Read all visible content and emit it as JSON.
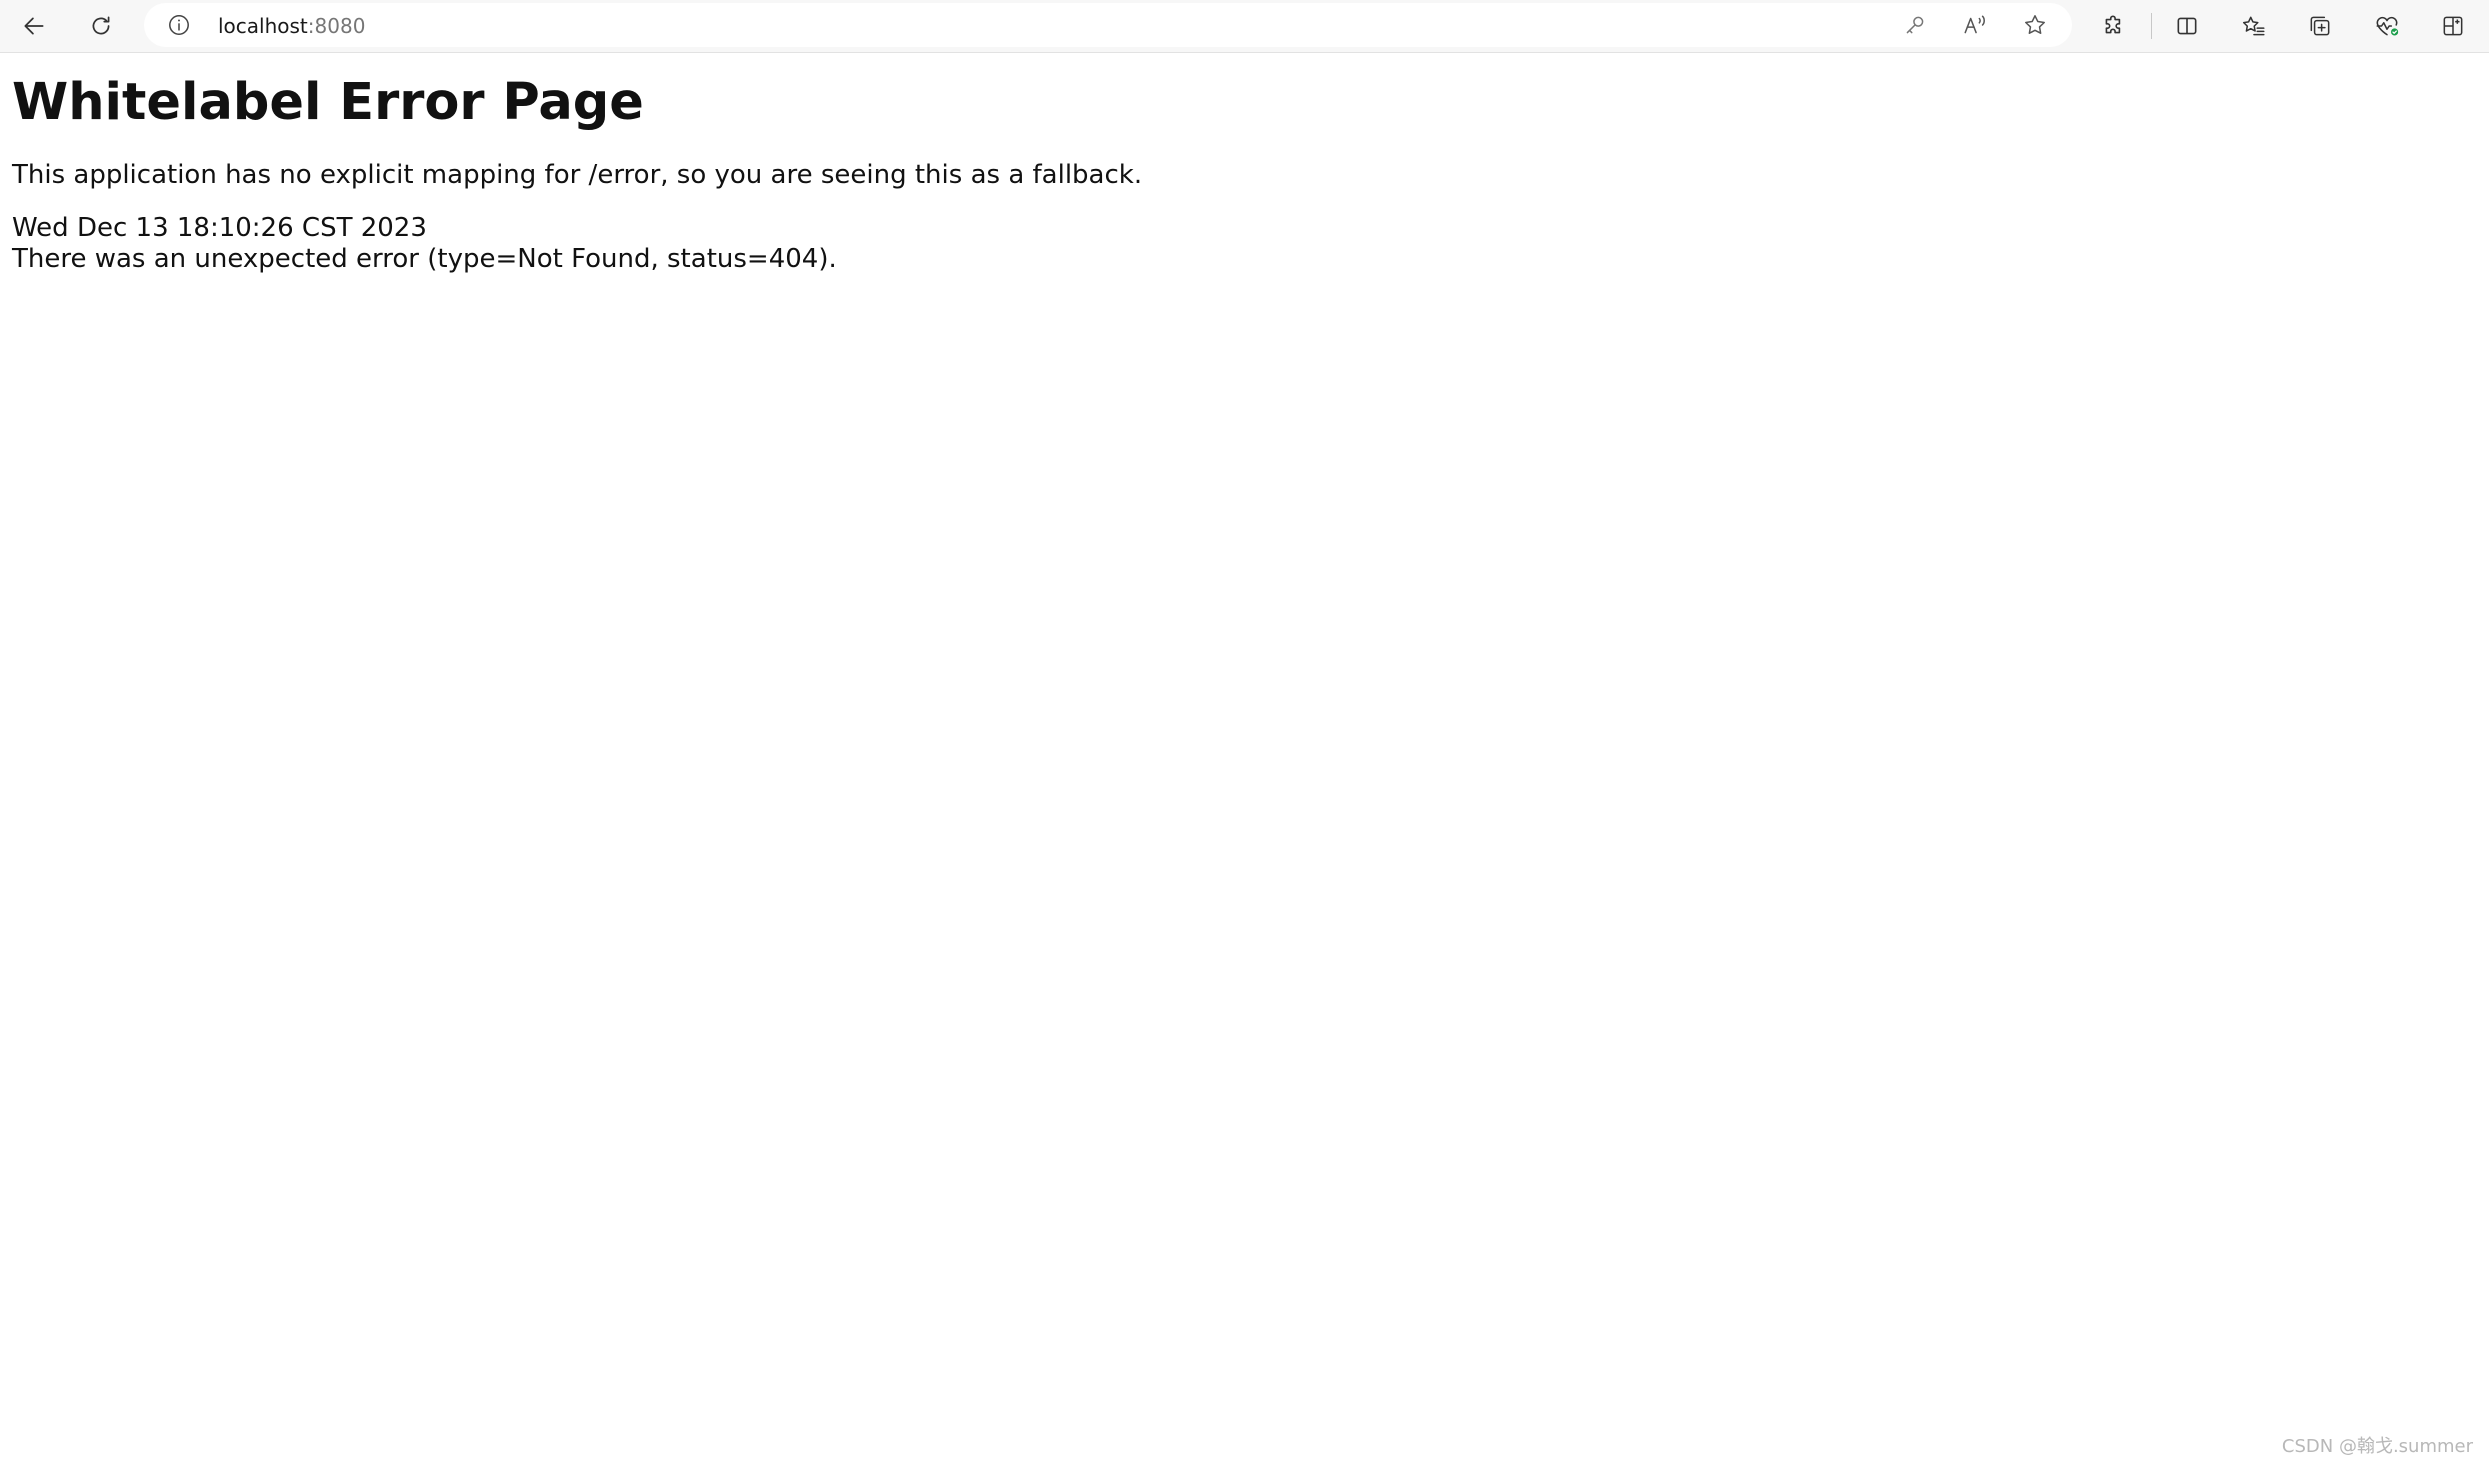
{
  "browser": {
    "address_bar": {
      "host": "localhost",
      "port": ":8080"
    },
    "icons": {
      "back": "back-arrow-icon",
      "refresh": "refresh-icon",
      "info": "info-icon",
      "password": "key-icon",
      "read_aloud": "read-aloud-icon",
      "favorite": "star-icon",
      "extensions": "extensions-icon",
      "split_screen": "split-screen-icon",
      "favorites": "favorites-icon",
      "collections": "collections-icon",
      "browser_essentials": "heart-pulse-icon",
      "sidebar": "sidebar-icon"
    }
  },
  "page": {
    "title": "Whitelabel Error Page",
    "message": "This application has no explicit mapping for /error, so you are seeing this as a fallback.",
    "timestamp": "Wed Dec 13 18:10:26 CST 2023",
    "error_detail": "There was an unexpected error (type=Not Found, status=404)."
  },
  "watermark": "CSDN @翰戈.summer"
}
